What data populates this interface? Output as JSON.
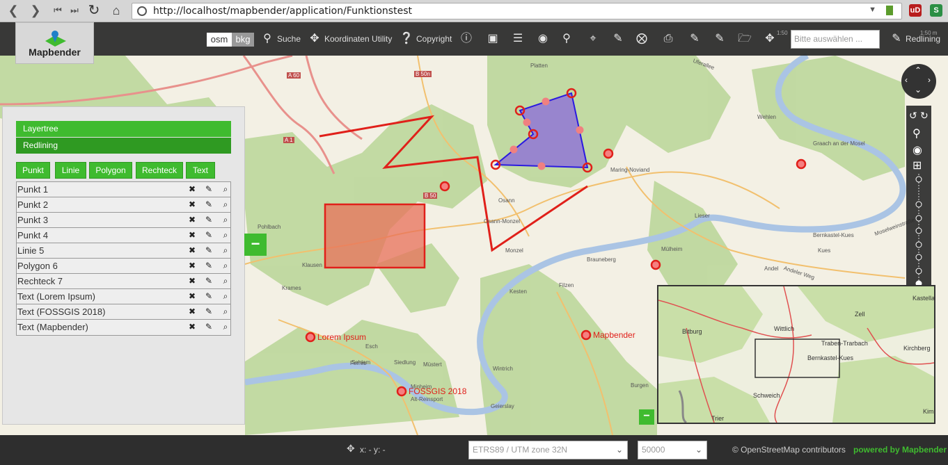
{
  "browser": {
    "url": "http://localhost/mapbender/application/Funktionstest",
    "extension1": "uD",
    "extension2": "S"
  },
  "toolbar": {
    "app_name": "Mapbender",
    "bg_osm": "osm",
    "bg_bkg": "bkg",
    "search": "Suche",
    "coords": "Koordinaten Utility",
    "copyright": "Copyright",
    "layer_select_placeholder": "Bitte auswählen ...",
    "redlining": "Redlining",
    "scale_left": "1:50",
    "scale_right": "1:50 m"
  },
  "sidebar": {
    "accordion": [
      "Layertree",
      "Redlining"
    ],
    "geom_buttons": [
      "Punkt",
      "Linie",
      "Polygon",
      "Rechteck",
      "Text"
    ],
    "features": [
      "Punkt 1",
      "Punkt 2",
      "Punkt 3",
      "Punkt 4",
      "Linie 5",
      "Polygon 6",
      "Rechteck 7",
      "Text (Lorem Ipsum)",
      "Text (FOSSGIS 2018)",
      "Text (Mapbender)"
    ],
    "collapse_symbol": "−"
  },
  "map": {
    "redline_texts": [
      "Lorem Ipsum",
      "FOSSGIS 2018",
      "Mapbender"
    ],
    "place_labels": [
      "Platten",
      "Wehlen",
      "Graach an der Mosel",
      "Maring-Noviand",
      "Osann",
      "Osann-Monzel",
      "Monzel",
      "Lieser",
      "Mülheim",
      "Bernkastel-Kues",
      "Kues",
      "Andel",
      "Brauneberg",
      "Kesten",
      "Filzen",
      "Klausen",
      "Krames",
      "Pohlbach",
      "Sehlem",
      "Esch",
      "Ferres",
      "Siedlung",
      "Müstert",
      "Minheim",
      "Alt-Reinsport",
      "Wintrich",
      "Burgen",
      "Geierslay",
      "Andeler Weg",
      "Moselweinstraße",
      "Uferallee",
      "A 60",
      "A 1",
      "B 50",
      "B 50n"
    ],
    "overview_labels": [
      "Kastellaun",
      "Zell",
      "Wittlich",
      "Traben-Trarbach",
      "Kirchberg",
      "Bitburg",
      "Bernkastel-Kues",
      "Schweich",
      "Trier",
      "Kim"
    ]
  },
  "statusbar": {
    "coords": "x: - y: -",
    "srs": "ETRS89 / UTM zone 32N",
    "scale": "50000",
    "attribution": "© OpenStreetMap contributors",
    "powered": "powered by Mapbender"
  },
  "colors": {
    "green": "#3fbb2f",
    "redline": "#e0201a",
    "polygon_fill": "#8d6fd8",
    "polygon_stroke": "#2a1ae0"
  }
}
